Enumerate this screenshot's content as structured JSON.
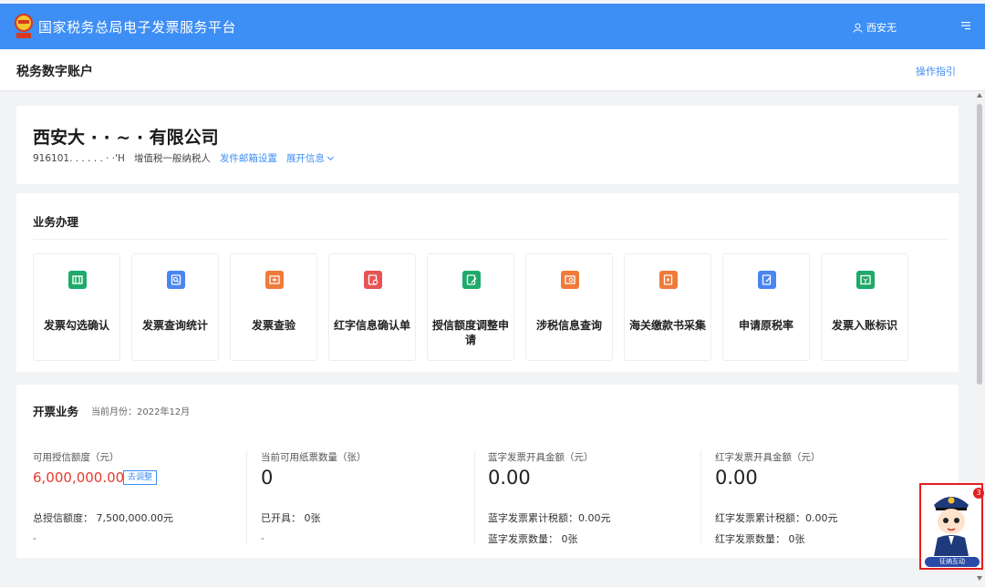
{
  "app": {
    "title": "国家税务总局电子发票服务平台",
    "user_name": "西安无",
    "emblem_icon": "tax-emblem-icon",
    "user_icon": "user-icon",
    "menu_icon": "menu-icon"
  },
  "subheader": {
    "title": "税务数字账户",
    "guide_link": "操作指引"
  },
  "company": {
    "name": "西安大 · · ~ · 有限公司",
    "tax_id": "916101. . . . . . · ·'H",
    "taxpayer_type": "增值税一般纳税人",
    "mail_setting_link": "发件邮箱设置",
    "expand_link": "展开信息"
  },
  "business": {
    "title": "业务办理",
    "tiles": [
      {
        "label": "发票勾选确认",
        "icon": "invoice-select-icon",
        "color": "#1faa6a"
      },
      {
        "label": "发票查询统计",
        "icon": "invoice-query-icon",
        "color": "#4a86f0"
      },
      {
        "label": "发票查验",
        "icon": "invoice-verify-icon",
        "color": "#f07a3a"
      },
      {
        "label": "红字信息确认单",
        "icon": "red-letter-confirm-icon",
        "color": "#e85454"
      },
      {
        "label": "授信额度调整申请",
        "icon": "credit-adjust-icon",
        "color": "#1faa6a"
      },
      {
        "label": "涉税信息查询",
        "icon": "tax-info-query-icon",
        "color": "#f07a3a"
      },
      {
        "label": "海关缴款书采集",
        "icon": "customs-payment-icon",
        "color": "#f07a3a"
      },
      {
        "label": "申请原税率",
        "icon": "original-rate-icon",
        "color": "#4a86f0"
      },
      {
        "label": "发票入账标识",
        "icon": "invoice-account-icon",
        "color": "#1faa6a"
      }
    ]
  },
  "invoicing": {
    "title": "开票业务",
    "month": "当前月份：2022年12月",
    "stats": [
      {
        "label": "可用授信额度（元）",
        "value": "6,000,000.00",
        "action": "去调整",
        "line1": "总授信额度： 7,500,000.00元",
        "line2": "-"
      },
      {
        "label": "当前可用纸票数量（张）",
        "value": "0",
        "line1": "已开具： 0张",
        "line2": "-"
      },
      {
        "label": "蓝字发票开具金额（元）",
        "value": "0.00",
        "line1": "蓝字发票累计税额：0.00元",
        "line2": "蓝字发票数量： 0张"
      },
      {
        "label": "红字发票开具金额（元）",
        "value": "0.00",
        "line1": "红字发票累计税额：0.00元",
        "line2": "红字发票数量： 0张"
      }
    ]
  },
  "assistant": {
    "badge": "3",
    "label": "征纳互动",
    "icon": "tax-officer-avatar-icon"
  }
}
